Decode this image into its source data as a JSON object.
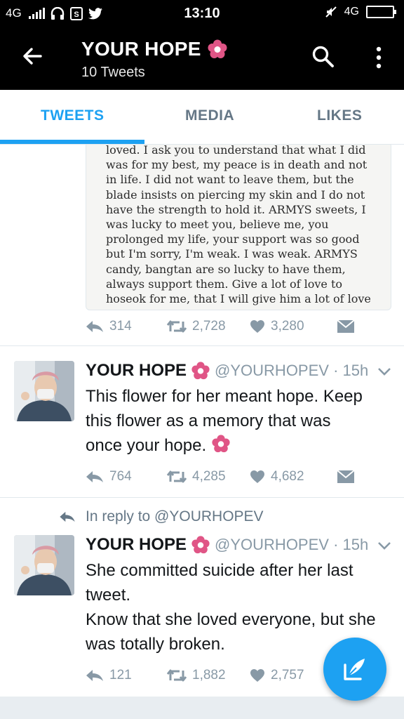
{
  "status_bar": {
    "network_left": "4G",
    "time": "13:10",
    "network_right": "4G",
    "icons": [
      "signal-bars-icon",
      "headphones-icon",
      "sim-icon",
      "twitter-bird-icon",
      "mute-icon",
      "battery-icon"
    ]
  },
  "header": {
    "title": "YOUR HOPE",
    "subtitle": "10 Tweets",
    "icons": [
      "back-arrow-icon",
      "flower-emoji-icon",
      "search-icon",
      "more-options-icon"
    ]
  },
  "tabs": [
    {
      "label": "TWEETS",
      "active": true
    },
    {
      "label": "MEDIA",
      "active": false
    },
    {
      "label": "LIKES",
      "active": false
    }
  ],
  "colors": {
    "accent": "#1da1f2",
    "header_bg": "#000000",
    "muted": "#8899a6",
    "divider": "#e1e8ed",
    "flower": "#e05586"
  },
  "tweets": [
    {
      "image_text": "loved. I ask you to understand that what I did\nwas for my best, my peace is in death and not\nin life. I did not want to leave them, but the\nblade insists on piercing my skin and I do not\nhave the strength to hold it. ARMYS sweets, I\nwas lucky to meet you, believe me, you\nprolonged my life, your support was so good\nbut I'm sorry, I'm weak. I was weak. ARMYS\ncandy, bangtan are so lucky to have them,\nalways support them. Give a lot of love to\nhoseok for me, that I will give him a lot of love",
      "stats": {
        "replies": "314",
        "retweets": "2,728",
        "likes": "3,280"
      }
    },
    {
      "name": "YOUR HOPE",
      "handle": "@YOURHOPEV",
      "time": "15h",
      "text": "This flower for her meant hope. Keep\nthis flower as a memory that was\nonce your hope.",
      "stats": {
        "replies": "764",
        "retweets": "4,285",
        "likes": "4,682"
      }
    },
    {
      "reply_context": "In reply to @YOURHOPEV",
      "name": "YOUR HOPE",
      "handle": "@YOURHOPEV",
      "time": "15h",
      "text": "She committed suicide after her last\ntweet.\nKnow that she loved everyone, but she\nwas totally broken.",
      "stats": {
        "replies": "121",
        "retweets": "1,882",
        "likes": "2,757"
      }
    }
  ],
  "fab": {
    "icon": "compose-tweet-icon"
  }
}
